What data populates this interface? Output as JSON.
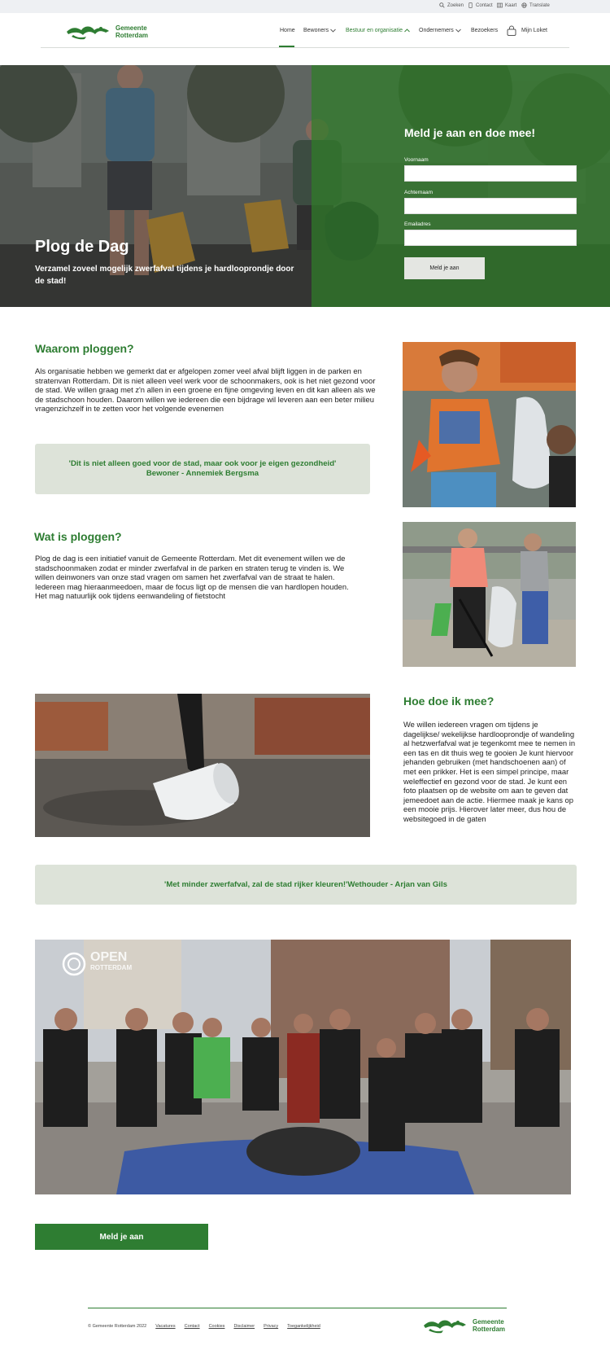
{
  "utility": {
    "search": "Zoeken",
    "contact": "Contact",
    "map": "Kaart",
    "translate": "Translate"
  },
  "header": {
    "logo_line1": "Gemeente",
    "logo_line2": "Rotterdam",
    "nav": {
      "home": "Home",
      "residents": "Bewoners",
      "governance": "Bestuur en organisatie",
      "entrepreneurs": "Ondernemers",
      "visitors": "Bezoekers",
      "my_portal": "Mijn Loket"
    }
  },
  "hero": {
    "title": "Plog de Dag",
    "subtitle": "Verzamel zoveel mogelijk zwerfafval tijdens je hardlooprondje door de stad!",
    "form": {
      "title": "Meld je aan en doe mee!",
      "first_name_label": "Voornaam",
      "last_name_label": "Achternaam",
      "email_label": "Emailadres",
      "submit_label": "Meld je aan"
    }
  },
  "sections": {
    "why": {
      "title": "Waarom ploggen?",
      "body": "Als organisatie hebben we gemerkt dat er afgelopen zomer veel afval blijft liggen in de parken en stratenvan Rotterdam. Dit is niet alleen veel werk voor de schoonmakers, ook is het niet gezond voor de stad. We willen graag met z'n allen in een groene en fijne omgeving leven en dit kan alleen als we de stadschoon houden. Daarom willen we iedereen die een bijdrage wil leveren aan een beter milieu vragenzichzelf in te zetten voor het volgende evenemen"
    },
    "quote1": {
      "line1": "'Dit is niet alleen goed voor de stad, maar ook voor je eigen gezondheid'",
      "line2": "Bewoner - Annemiek Bergsma"
    },
    "what": {
      "title": "Wat is ploggen?",
      "body": "Plog de dag is een initiatief vanuit de Gemeente Rotterdam. Met dit evenement willen we de stadschoonmaken zodat er minder zwerfafval in de parken en straten terug te vinden is. We willen deinwoners van onze stad vragen om samen het zwerfafval van de straat te halen. Iedereen mag hieraanmeedoen, maar de focus ligt op de mensen die van hardlopen houden. Het mag natuurlijk ook tijdens eenwandeling of fietstocht"
    },
    "how": {
      "title": "Hoe doe ik mee?",
      "body": "We willen iedereen vragen om tijdens je dagelijkse/ wekelijkse hardlooprondje of wandeling al hetzwerfafval wat je tegenkomt mee te nemen in een tas en dit thuis weg te gooien Je kunt hiervoor jehanden gebruiken (met handschoenen aan) of met een prikker. Het is een simpel principe, maar weleffectief en gezond voor de stad. Je kunt een foto plaatsen op de website om aan te geven dat jemeedoet aan de actie. Hiermee maak je kans op een mooie prijs. Hierover later meer, dus hou de websitegoed in de gaten"
    },
    "quote2": {
      "text": "'Met minder zwerfafval, zal de stad rijker kleuren!'Wethouder - Arjan van Gils"
    },
    "video": {
      "watermark_line1": "OPEN",
      "watermark_line2": "ROTTERDAM"
    }
  },
  "cta": {
    "label": "Meld je aan"
  },
  "footer": {
    "copyright": "© Gemeente Rotterdam 2022",
    "links": [
      "Vacatures",
      "Contact",
      "Cookies",
      "Disclaimer",
      "Privacy",
      "Toegankelijkheid"
    ],
    "logo_line1": "Gemeente",
    "logo_line2": "Rotterdam"
  },
  "colors": {
    "brand_green": "#2e7d32",
    "quote_bg": "#dde3d9",
    "utility_bg": "#eef0f3"
  }
}
